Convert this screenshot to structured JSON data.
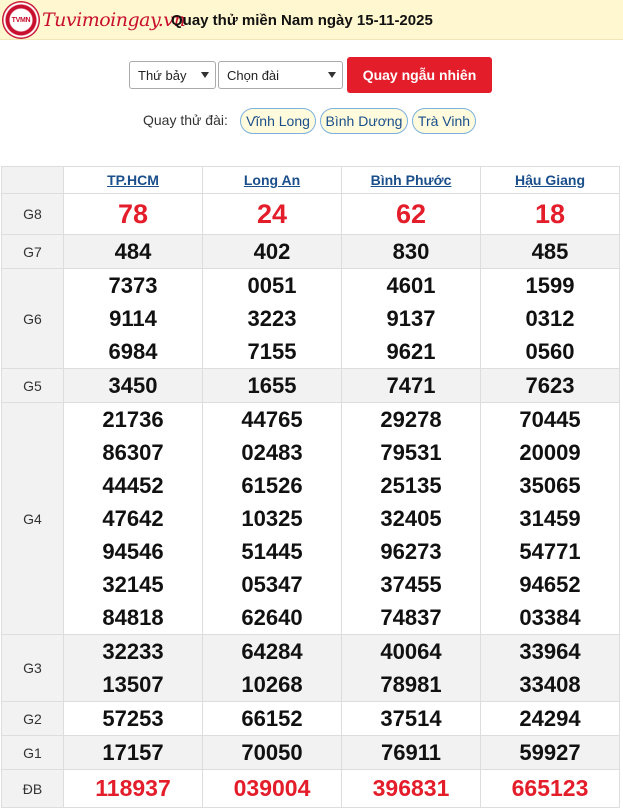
{
  "header": {
    "logo_text": "TVMN",
    "brand": "Tuvimoingay.vn",
    "title": "Quay thử miền Nam ngày 15-11-2025"
  },
  "controls": {
    "day_select": "Thứ bảy",
    "station_select": "Chọn đài",
    "random_button": "Quay ngẫu nhiên"
  },
  "try_stations": {
    "label": "Quay thử đài:",
    "items": [
      "Vĩnh Long",
      "Bình Dương",
      "Trà Vinh"
    ]
  },
  "table": {
    "columns": [
      "TP.HCM",
      "Long An",
      "Bình Phước",
      "Hậu Giang"
    ],
    "rows": [
      {
        "label": "G8",
        "values": [
          [
            "78"
          ],
          [
            "24"
          ],
          [
            "62"
          ],
          [
            "18"
          ]
        ]
      },
      {
        "label": "G7",
        "values": [
          [
            "484"
          ],
          [
            "402"
          ],
          [
            "830"
          ],
          [
            "485"
          ]
        ]
      },
      {
        "label": "G6",
        "values": [
          [
            "7373",
            "9114",
            "6984"
          ],
          [
            "0051",
            "3223",
            "7155"
          ],
          [
            "4601",
            "9137",
            "9621"
          ],
          [
            "1599",
            "0312",
            "0560"
          ]
        ]
      },
      {
        "label": "G5",
        "values": [
          [
            "3450"
          ],
          [
            "1655"
          ],
          [
            "7471"
          ],
          [
            "7623"
          ]
        ]
      },
      {
        "label": "G4",
        "values": [
          [
            "21736",
            "86307",
            "44452",
            "47642",
            "94546",
            "32145",
            "84818"
          ],
          [
            "44765",
            "02483",
            "61526",
            "10325",
            "51445",
            "05347",
            "62640"
          ],
          [
            "29278",
            "79531",
            "25135",
            "32405",
            "96273",
            "37455",
            "74837"
          ],
          [
            "70445",
            "20009",
            "35065",
            "31459",
            "54771",
            "94652",
            "03384"
          ]
        ]
      },
      {
        "label": "G3",
        "values": [
          [
            "32233",
            "13507"
          ],
          [
            "64284",
            "10268"
          ],
          [
            "40064",
            "78981"
          ],
          [
            "33964",
            "33408"
          ]
        ]
      },
      {
        "label": "G2",
        "values": [
          [
            "57253"
          ],
          [
            "66152"
          ],
          [
            "37514"
          ],
          [
            "24294"
          ]
        ]
      },
      {
        "label": "G1",
        "values": [
          [
            "17157"
          ],
          [
            "70050"
          ],
          [
            "76911"
          ],
          [
            "59927"
          ]
        ]
      },
      {
        "label": "ĐB",
        "values": [
          [
            "118937"
          ],
          [
            "039004"
          ],
          [
            "396831"
          ],
          [
            "665123"
          ]
        ]
      }
    ]
  },
  "colors": {
    "accent_red": "#e41d2b",
    "link_blue": "#1a4f8b",
    "header_bg": "#fff7cf"
  }
}
